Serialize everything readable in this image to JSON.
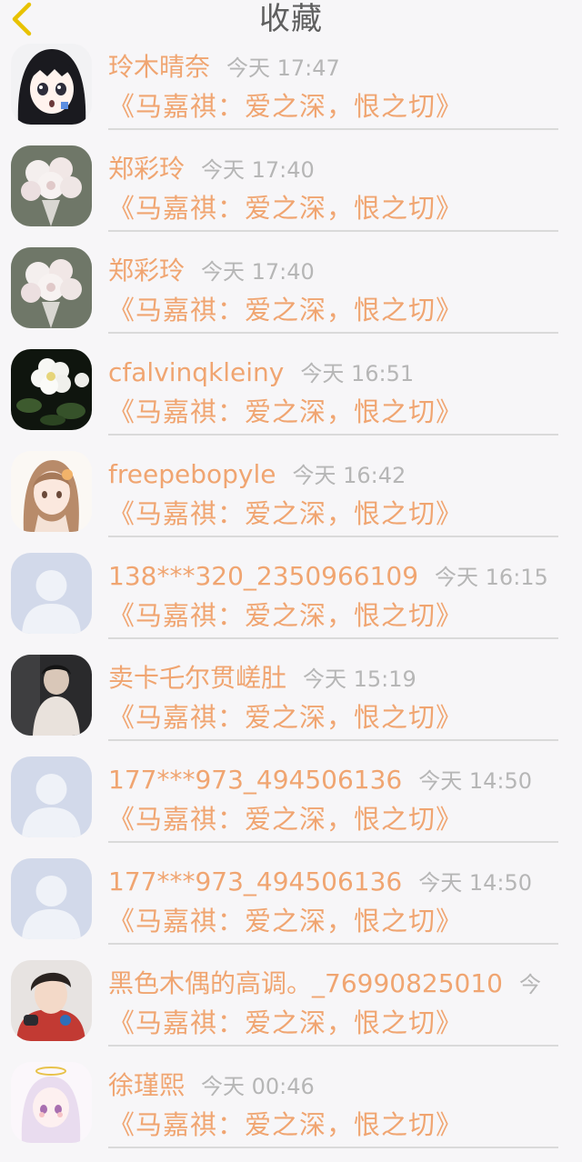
{
  "header": {
    "title": "收藏",
    "back_icon": "chevron-left-icon",
    "accent": "#f0c300"
  },
  "colors": {
    "accent": "#f0a571",
    "muted": "#b6b6b6",
    "background": "#f7f6f8"
  },
  "favorites": [
    {
      "user": "玲木晴奈",
      "time": "今天 17:47",
      "title": "《马嘉祺：爱之深，恨之切》",
      "avatar": "anime-girl-avatar"
    },
    {
      "user": "郑彩玲",
      "time": "今天 17:40",
      "title": "《马嘉祺：爱之深，恨之切》",
      "avatar": "flower-bouquet-avatar"
    },
    {
      "user": "郑彩玲",
      "time": "今天 17:40",
      "title": "《马嘉祺：爱之深，恨之切》",
      "avatar": "flower-bouquet-avatar"
    },
    {
      "user": "cfalvinqkleiny",
      "time": "今天 16:51",
      "title": "《马嘉祺：爱之深，恨之切》",
      "avatar": "white-flower-avatar"
    },
    {
      "user": "freepebopyle",
      "time": "今天 16:42",
      "title": "《马嘉祺：爱之深，恨之切》",
      "avatar": "illustrated-girl-avatar"
    },
    {
      "user": "138***320_2350966109",
      "time": "今天 16:15",
      "title": "《马嘉祺：爱之深，恨之切》",
      "avatar": "default-user-avatar"
    },
    {
      "user": "卖卡乇尔贯嵯肚",
      "time": "今天 15:19",
      "title": "《马嘉祺：爱之深，恨之切》",
      "avatar": "photo-boy-avatar"
    },
    {
      "user": "177***973_494506136",
      "time": "今天 14:50",
      "title": "《马嘉祺：爱之深，恨之切》",
      "avatar": "default-user-avatar"
    },
    {
      "user": "177***973_494506136",
      "time": "今天 14:50",
      "title": "《马嘉祺：爱之深，恨之切》",
      "avatar": "default-user-avatar"
    },
    {
      "user": "黑色木偶的高调。_76990825010",
      "time": "今",
      "title": "《马嘉祺：爱之深，恨之切》",
      "avatar": "cartoon-boy-avatar"
    },
    {
      "user": "徐瑾熙",
      "time": "今天 00:46",
      "title": "《马嘉祺：爱之深，恨之切》",
      "avatar": "angel-girl-avatar"
    }
  ]
}
